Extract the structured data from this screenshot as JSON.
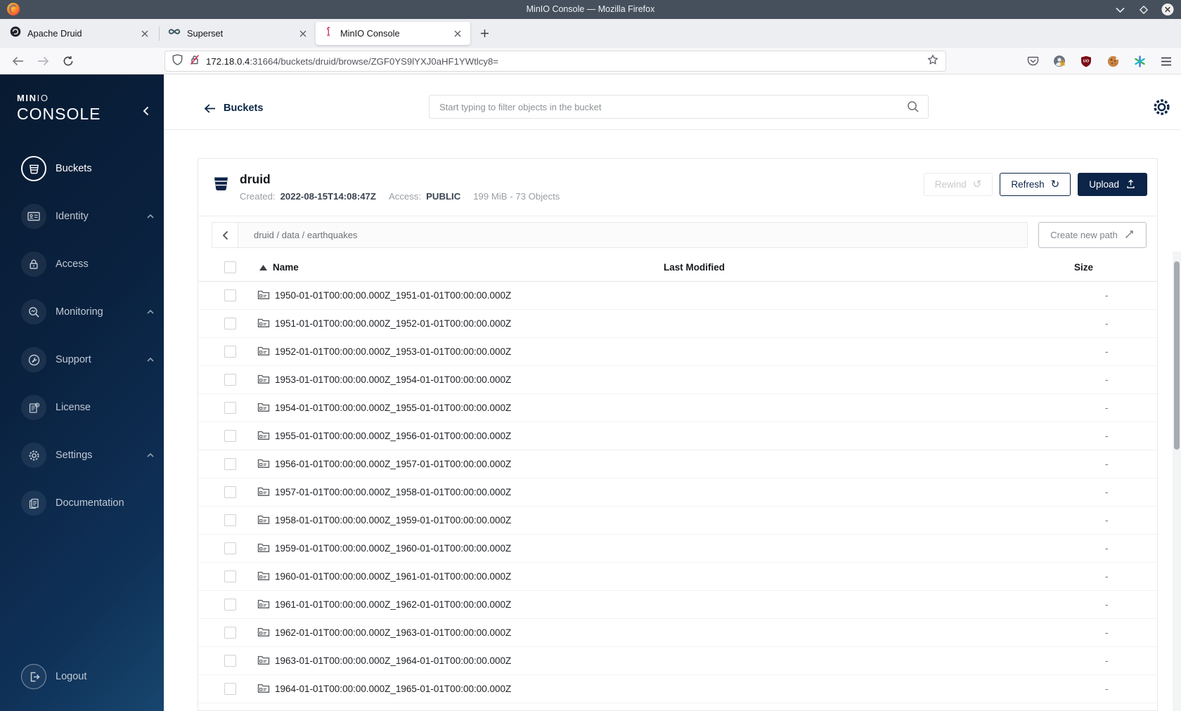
{
  "window": {
    "title": "MinIO Console — Mozilla Firefox"
  },
  "tabs": [
    {
      "label": "Apache Druid"
    },
    {
      "label": "Superset"
    },
    {
      "label": "MinIO Console"
    }
  ],
  "address": {
    "host": "172.18.0.4",
    "path": ":31664/buckets/druid/browse/ZGF0YS9lYXJ0aHF1YWtlcy8="
  },
  "sidebar": {
    "brand_bold": "MIN",
    "brand_light": "IO",
    "brand_sub": "CONSOLE",
    "items": [
      {
        "label": "Buckets"
      },
      {
        "label": "Identity"
      },
      {
        "label": "Access"
      },
      {
        "label": "Monitoring"
      },
      {
        "label": "Support"
      },
      {
        "label": "License"
      },
      {
        "label": "Settings"
      },
      {
        "label": "Documentation"
      }
    ],
    "logout_label": "Logout"
  },
  "topbar": {
    "back_label": "Buckets",
    "search_placeholder": "Start typing to filter objects in the bucket"
  },
  "bucket": {
    "name": "druid",
    "created_label": "Created:",
    "created_value": "2022-08-15T14:08:47Z",
    "access_label": "Access:",
    "access_value": "PUBLIC",
    "summary": "199 MiB - 73 Objects",
    "rewind_label": "Rewind",
    "refresh_label": "Refresh",
    "upload_label": "Upload"
  },
  "browse": {
    "breadcrumb": "druid / data / earthquakes",
    "create_path_label": "Create new path"
  },
  "table": {
    "columns": [
      "Name",
      "Last Modified",
      "Size"
    ],
    "rows": [
      {
        "name": "1950-01-01T00:00:00.000Z_1951-01-01T00:00:00.000Z",
        "modified": "",
        "size": "-"
      },
      {
        "name": "1951-01-01T00:00:00.000Z_1952-01-01T00:00:00.000Z",
        "modified": "",
        "size": "-"
      },
      {
        "name": "1952-01-01T00:00:00.000Z_1953-01-01T00:00:00.000Z",
        "modified": "",
        "size": "-"
      },
      {
        "name": "1953-01-01T00:00:00.000Z_1954-01-01T00:00:00.000Z",
        "modified": "",
        "size": "-"
      },
      {
        "name": "1954-01-01T00:00:00.000Z_1955-01-01T00:00:00.000Z",
        "modified": "",
        "size": "-"
      },
      {
        "name": "1955-01-01T00:00:00.000Z_1956-01-01T00:00:00.000Z",
        "modified": "",
        "size": "-"
      },
      {
        "name": "1956-01-01T00:00:00.000Z_1957-01-01T00:00:00.000Z",
        "modified": "",
        "size": "-"
      },
      {
        "name": "1957-01-01T00:00:00.000Z_1958-01-01T00:00:00.000Z",
        "modified": "",
        "size": "-"
      },
      {
        "name": "1958-01-01T00:00:00.000Z_1959-01-01T00:00:00.000Z",
        "modified": "",
        "size": "-"
      },
      {
        "name": "1959-01-01T00:00:00.000Z_1960-01-01T00:00:00.000Z",
        "modified": "",
        "size": "-"
      },
      {
        "name": "1960-01-01T00:00:00.000Z_1961-01-01T00:00:00.000Z",
        "modified": "",
        "size": "-"
      },
      {
        "name": "1961-01-01T00:00:00.000Z_1962-01-01T00:00:00.000Z",
        "modified": "",
        "size": "-"
      },
      {
        "name": "1962-01-01T00:00:00.000Z_1963-01-01T00:00:00.000Z",
        "modified": "",
        "size": "-"
      },
      {
        "name": "1963-01-01T00:00:00.000Z_1964-01-01T00:00:00.000Z",
        "modified": "",
        "size": "-"
      },
      {
        "name": "1964-01-01T00:00:00.000Z_1965-01-01T00:00:00.000Z",
        "modified": "",
        "size": "-"
      }
    ]
  }
}
